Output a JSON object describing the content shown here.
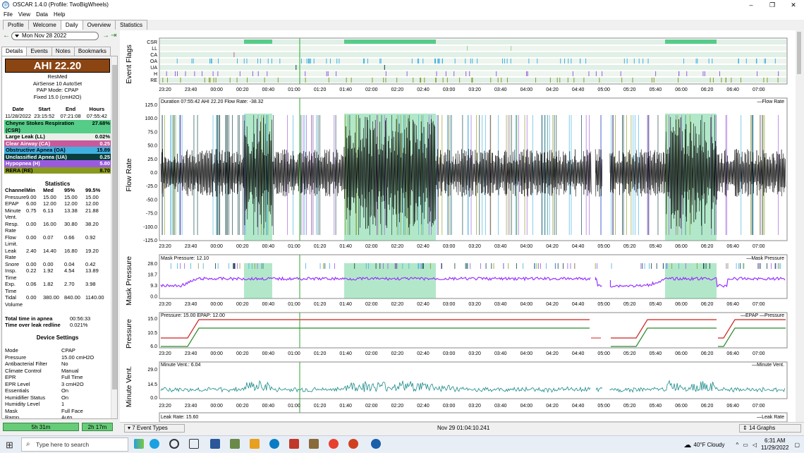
{
  "window": {
    "title": "OSCAR 1.4.0 (Profile: TwoBigWheels)"
  },
  "menu": [
    "File",
    "View",
    "Data",
    "Help"
  ],
  "main_tabs": [
    "Profile",
    "Welcome",
    "Daily",
    "Overview",
    "Statistics"
  ],
  "date": "Mon Nov 28 2022",
  "side_tabs": [
    "Details",
    "Events",
    "Notes",
    "Bookmarks"
  ],
  "ahi": "AHI 22.20",
  "device": [
    "ResMed",
    "AirSense 10 AutoSet",
    "PAP Mode: CPAP",
    "Fixed 15.0 (cmH2O)"
  ],
  "session_header": [
    "Date",
    "Start",
    "End",
    "Hours"
  ],
  "session_row": [
    "11/28/2022",
    "23:15:52",
    "07:21:08",
    "07:55:42"
  ],
  "events": [
    {
      "label": "Cheyne Stokes Respiration",
      "label2": "(CSR)",
      "value": "27.68%",
      "color": "#55cc88",
      "text": "#000"
    },
    {
      "label": "Large Leak (LL)",
      "value": "0.02%",
      "color": "#e8f0e8",
      "text": "#000"
    },
    {
      "label": "Clear Airway (CA)",
      "value": "0.25",
      "color": "#c85a9b",
      "text": "#fff"
    },
    {
      "label": "Obstructive Apnea (OA)",
      "value": "15.89",
      "color": "#40b0e0",
      "text": "#000"
    },
    {
      "label": "Unclassified Apnea (UA)",
      "value": "0.25",
      "color": "#0a3d3d",
      "text": "#fff"
    },
    {
      "label": "Hypopnea (H)",
      "value": "5.80",
      "color": "#9a5ae0",
      "text": "#fff"
    },
    {
      "label": "RERA (RE)",
      "value": "8.70",
      "color": "#8a9a20",
      "text": "#000"
    }
  ],
  "stats_title": "Statistics",
  "stats_header": [
    "Channel",
    "Min",
    "Med",
    "95%",
    "99.5%"
  ],
  "stats": [
    [
      "Pressure",
      "9.00",
      "15.00",
      "15.00",
      "15.00"
    ],
    [
      "EPAP",
      "6.00",
      "12.00",
      "12.00",
      "12.00"
    ],
    [
      "Minute Vent.",
      "0.75",
      "6.13",
      "13.38",
      "21.88"
    ],
    [
      "Resp. Rate",
      "0.00",
      "16.00",
      "30.80",
      "38.20"
    ],
    [
      "Flow Limit.",
      "0.00",
      "0.07",
      "0.66",
      "0.92"
    ],
    [
      "Leak Rate",
      "2.40",
      "14.40",
      "16.80",
      "19.20"
    ],
    [
      "Snore",
      "0.00",
      "0.00",
      "0.04",
      "0.42"
    ],
    [
      "Insp. Time",
      "0.22",
      "1.92",
      "4.54",
      "13.89"
    ],
    [
      "Exp. Time",
      "0.06",
      "1.82",
      "2.70",
      "3.98"
    ],
    [
      "Tidal Volume",
      "0.00",
      "380.00",
      "840.00",
      "1140.00"
    ]
  ],
  "summary": [
    [
      "Total time in apnea",
      "00:56:33"
    ],
    [
      "Time over leak redline",
      "0.021%"
    ]
  ],
  "settings_title": "Device Settings",
  "settings": [
    [
      "Mode",
      "CPAP"
    ],
    [
      "Pressure",
      "15.00 cmH2O"
    ],
    [
      "Antibacterial Filter",
      "No"
    ],
    [
      "Climate Control",
      "Manual"
    ],
    [
      "EPR",
      "Full Time"
    ],
    [
      "EPR Level",
      "3 cmH2O"
    ],
    [
      "Essentials",
      "On"
    ],
    [
      "Humidifier Status",
      "On"
    ],
    [
      "Humidity Level",
      "1"
    ],
    [
      "Mask",
      "Full Face"
    ],
    [
      "Ramp",
      "Auto"
    ]
  ],
  "bottom_left": [
    "5h 31m",
    "2h 17m"
  ],
  "x_ticks": [
    "23:20",
    "23:40",
    "00:00",
    "00:20",
    "00:40",
    "01:00",
    "01:20",
    "01:40",
    "02:00",
    "02:20",
    "02:40",
    "03:00",
    "03:20",
    "03:40",
    "04:00",
    "04:20",
    "04:40",
    "05:00",
    "05:20",
    "05:40",
    "06:00",
    "06:20",
    "06:40",
    "07:00"
  ],
  "event_flags": {
    "title": "Event Flags",
    "rows": [
      "CSR",
      "LL",
      "CA",
      "OA",
      "UA",
      "H",
      "RE"
    ]
  },
  "flow": {
    "title": "Flow Rate",
    "header": "Duration 07:55:42 AHI 22.20 Flow Rate: -38.32",
    "legend": "Flow Rate",
    "yticks": [
      "125.0",
      "100.0",
      "75.0",
      "50.0",
      "25.0",
      "0.0",
      "-25.0",
      "-50.0",
      "-75.0",
      "-100.0",
      "-125.0"
    ]
  },
  "mask": {
    "title": "Mask Pressure",
    "header": "Mask Pressure: 12.10",
    "legend": "Mask Pressure",
    "yticks": [
      "28.0",
      "18.7",
      "9.3",
      "0.0"
    ]
  },
  "pressure": {
    "title": "Pressure",
    "header": "Pressure: 15.00 EPAP: 12.00",
    "legend1": "EPAP",
    "legend2": "Pressure",
    "yticks": [
      "15.0",
      "10.5",
      "6.0"
    ]
  },
  "minvent": {
    "title": "Minute Vent.",
    "header": "Minute Vent.: 6.04",
    "legend": "Minute Vent.",
    "yticks": [
      "29.0",
      "14.5",
      "0.0"
    ]
  },
  "leak": {
    "header": "Leak Rate: 15.60",
    "legend": "Leak Rate"
  },
  "status": {
    "event_types": "7 Event Types",
    "time": "Nov 29 01:04:10.241",
    "graphs": "14 Graphs"
  },
  "taskbar": {
    "search": "Type here to search",
    "weather": "40°F  Cloudy",
    "time": "6:31 AM",
    "date": "11/29/2022"
  },
  "colors": {
    "csr": "#55cc88",
    "flow": "#000000",
    "mask": "#9933ff",
    "epap": "#2a8a2a",
    "pressure": "#cc2222",
    "minvent": "#1a8a8a",
    "cursor": "#2aa82a",
    "ahi_bg": "#8b4513"
  }
}
